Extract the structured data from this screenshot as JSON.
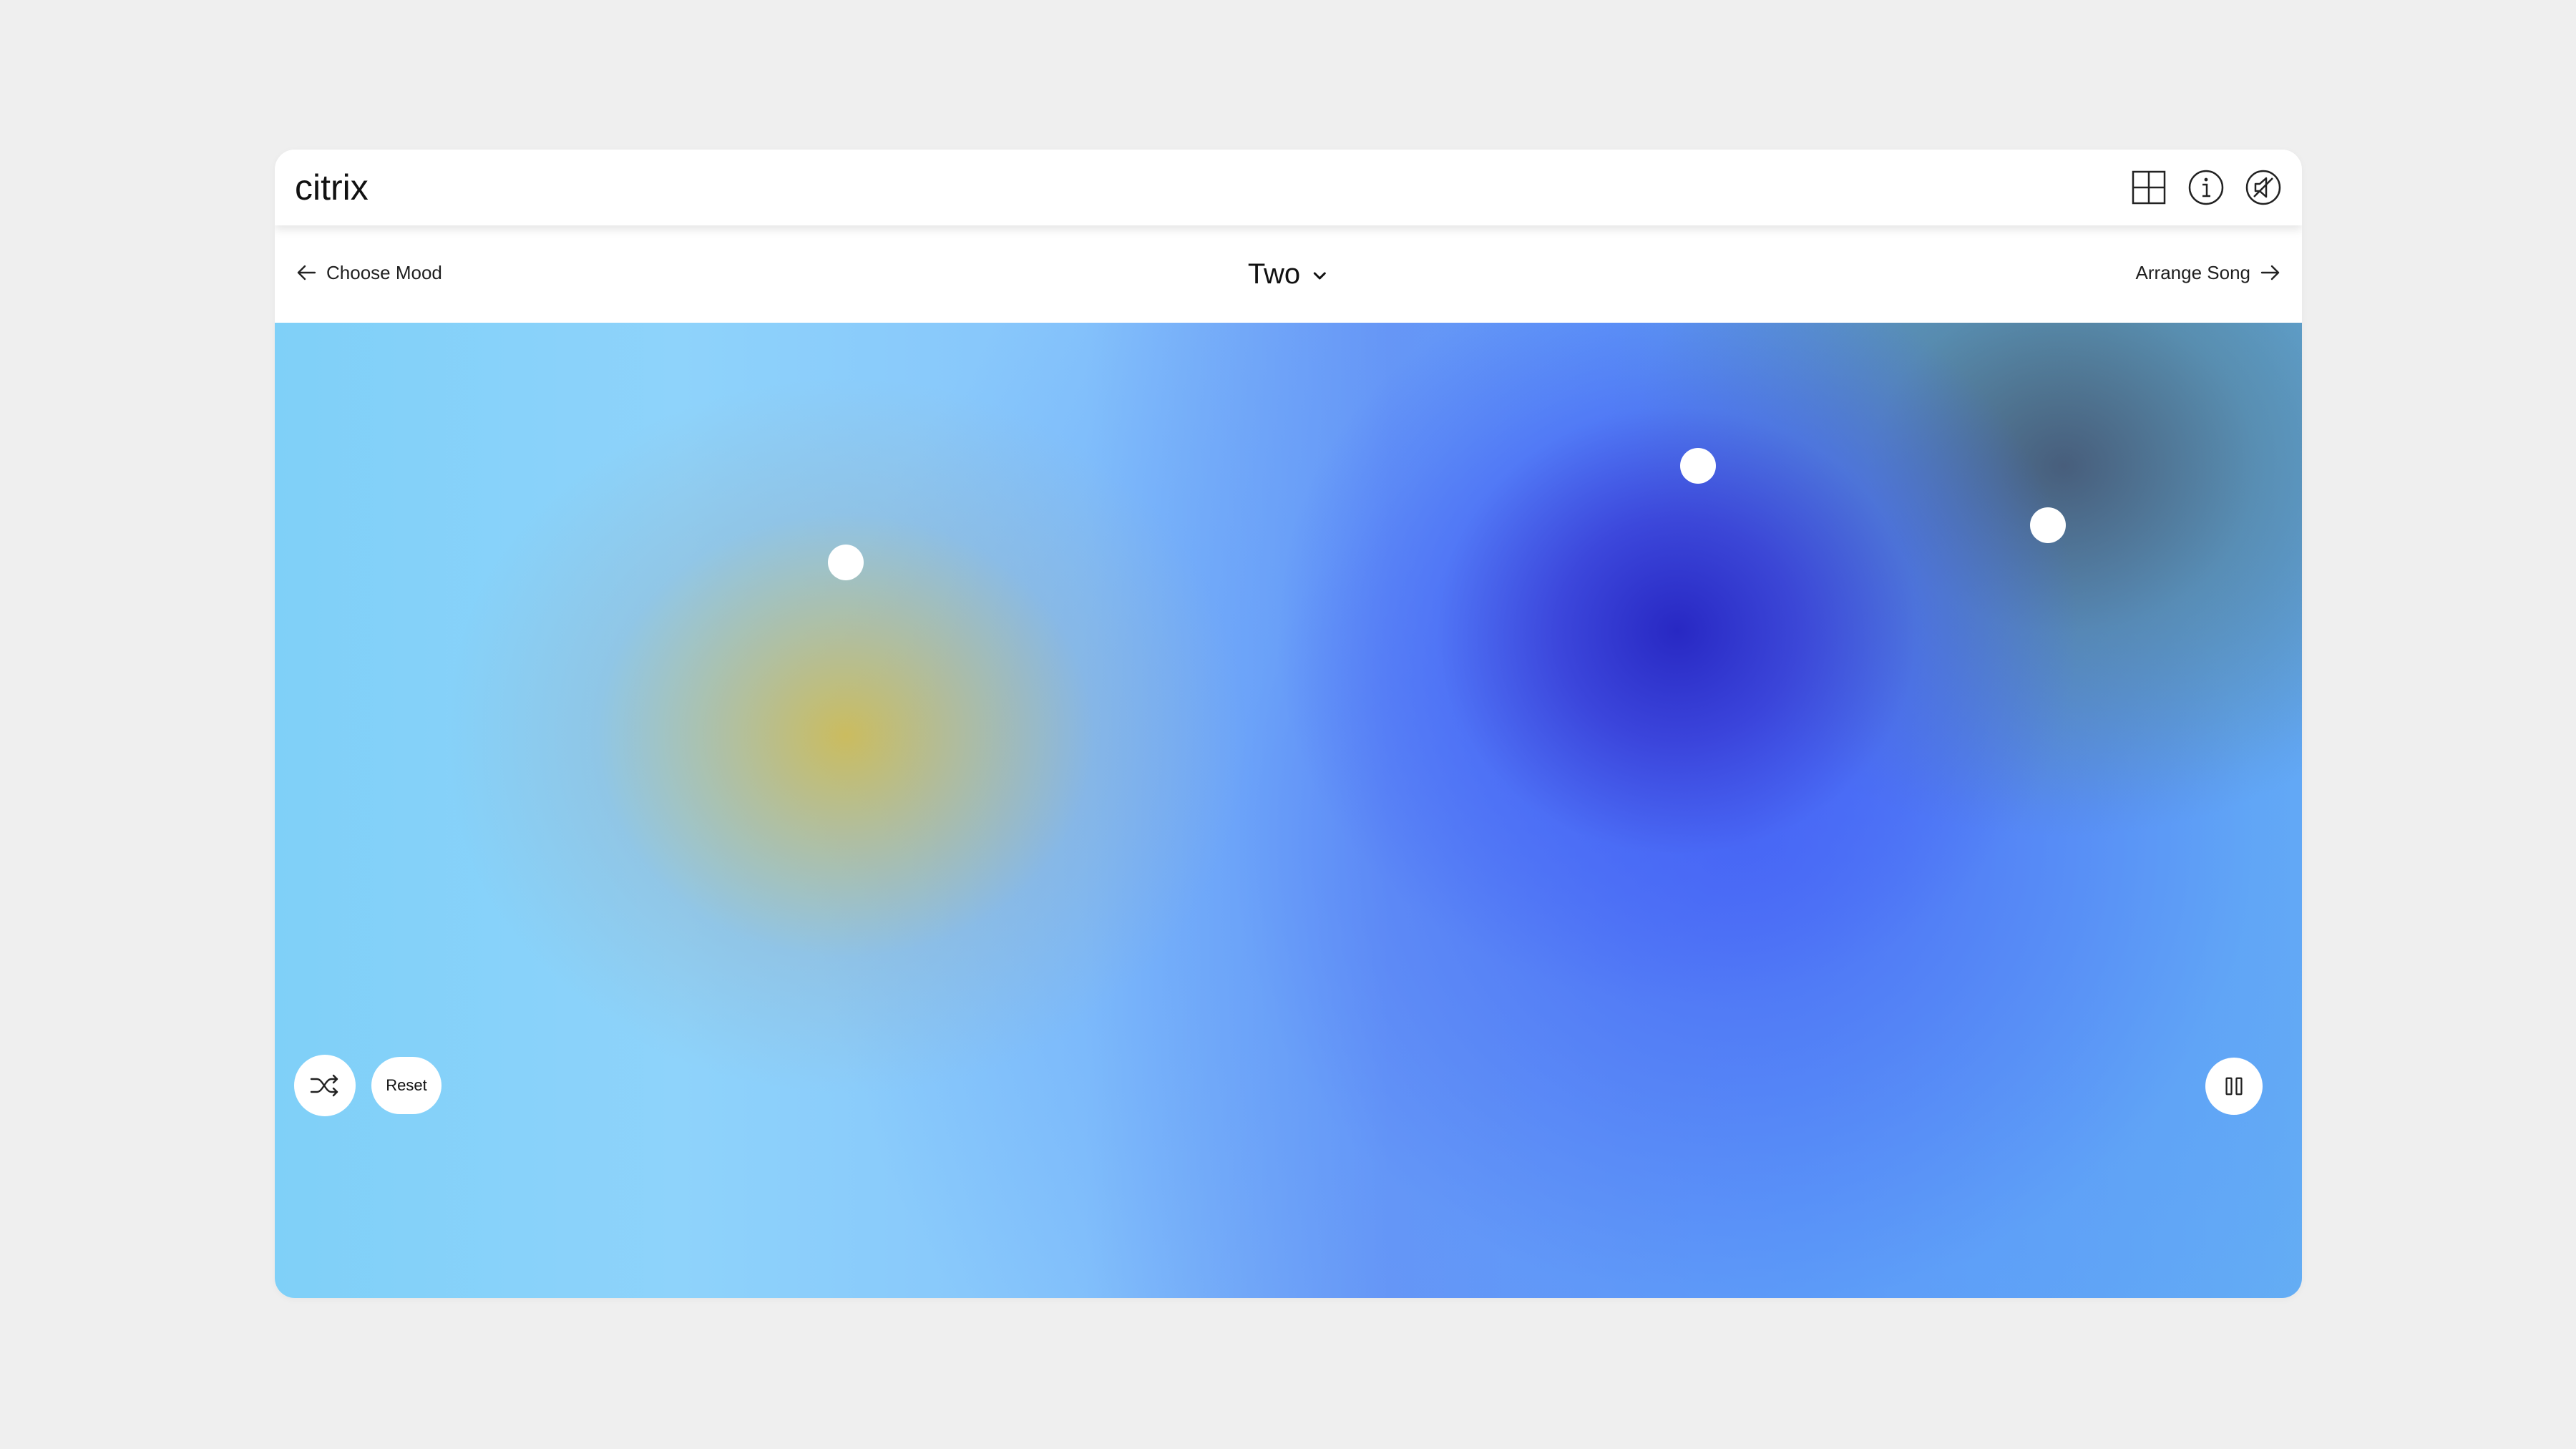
{
  "brand": {
    "logo_text": "citrix"
  },
  "toolbar": {
    "icons": [
      "grid-icon",
      "info-icon",
      "sound-off-icon"
    ]
  },
  "nav": {
    "back_label": "Choose Mood",
    "forward_label": "Arrange Song",
    "mood_selected": "Two"
  },
  "controls": {
    "reset_label": "Reset",
    "shuffle_icon": "shuffle-icon",
    "pause_icon": "pause-icon"
  },
  "colors": {
    "accent_blue": "#3b3fd0",
    "accent_yellow": "#ccbc5c",
    "sky_blue": "#86cffa"
  }
}
